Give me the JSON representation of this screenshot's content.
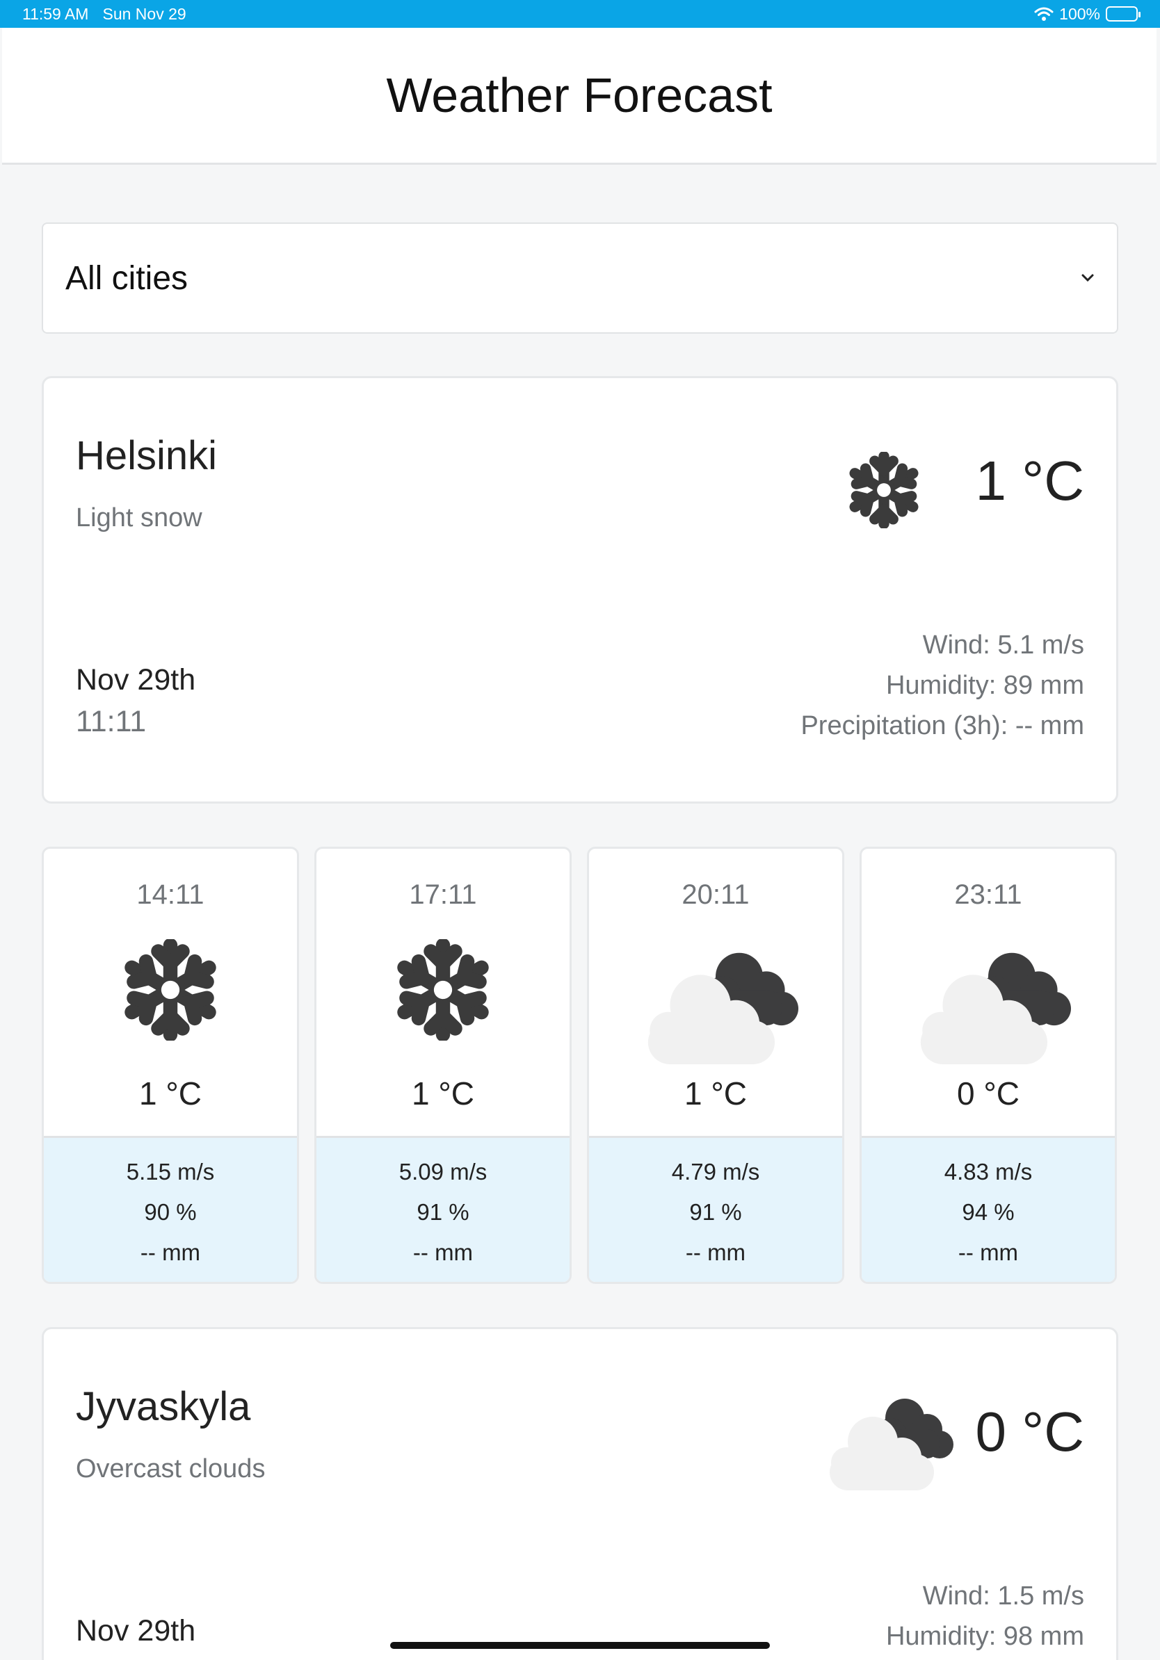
{
  "status_bar": {
    "time": "11:59 AM",
    "date": "Sun Nov 29",
    "battery": "100%",
    "wifi_icon": "wifi-icon"
  },
  "header": {
    "title": "Weather Forecast"
  },
  "city_select": {
    "value": "All cities",
    "chevron_icon": "chevron-down-icon"
  },
  "cities": [
    {
      "name": "Helsinki",
      "description": "Light snow",
      "temperature": "1 °C",
      "icon": "snowflake-icon",
      "date": "Nov 29th",
      "time": "11:11",
      "wind": "Wind: 5.1 m/s",
      "humidity": "Humidity: 89 mm",
      "precipitation": "Precipitation (3h): -- mm"
    },
    {
      "name": "Jyvaskyla",
      "description": "Overcast clouds",
      "temperature": "0 °C",
      "icon": "overcast-clouds-icon",
      "date": "Nov 29th",
      "wind": "Wind: 1.5 m/s",
      "humidity": "Humidity: 98 mm"
    }
  ],
  "forecast": [
    {
      "time": "14:11",
      "icon": "snowflake-icon",
      "temperature": "1 °C",
      "wind": "5.15 m/s",
      "humidity": "90 %",
      "precipitation": "-- mm"
    },
    {
      "time": "17:11",
      "icon": "snowflake-icon",
      "temperature": "1 °C",
      "wind": "5.09 m/s",
      "humidity": "91 %",
      "precipitation": "-- mm"
    },
    {
      "time": "20:11",
      "icon": "overcast-clouds-icon",
      "temperature": "1 °C",
      "wind": "4.79 m/s",
      "humidity": "91 %",
      "precipitation": "-- mm"
    },
    {
      "time": "23:11",
      "icon": "overcast-clouds-icon",
      "temperature": "0 °C",
      "wind": "4.83 m/s",
      "humidity": "94 %",
      "precipitation": "-- mm"
    }
  ]
}
